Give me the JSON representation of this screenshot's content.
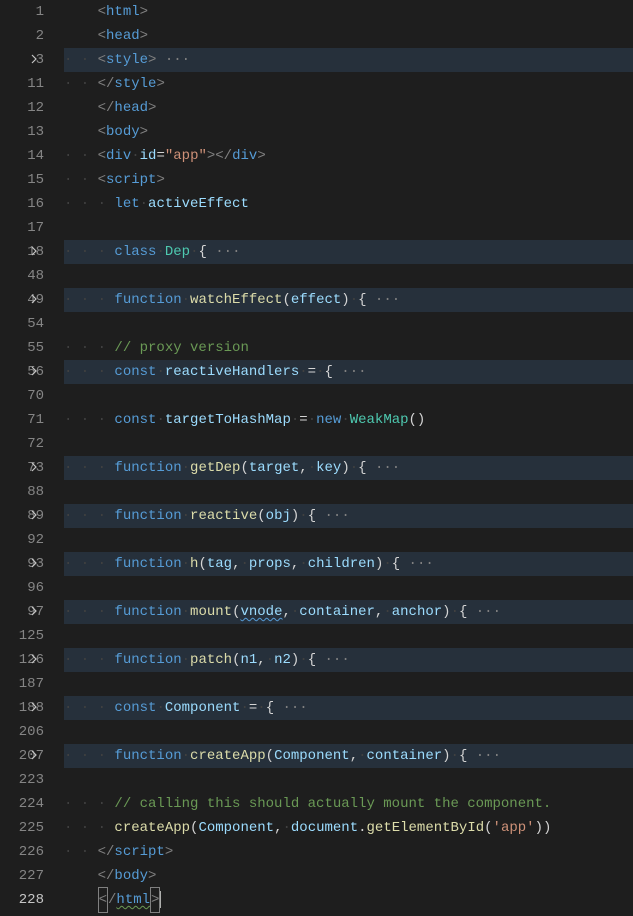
{
  "lines": [
    {
      "n": "1",
      "fold": false,
      "folded": false,
      "active": false,
      "seg": [
        {
          "t": "ws",
          "v": "    "
        },
        {
          "t": "tag-bracket",
          "v": "<"
        },
        {
          "t": "tag-name",
          "v": "html"
        },
        {
          "t": "tag-bracket",
          "v": ">"
        }
      ]
    },
    {
      "n": "2",
      "fold": false,
      "folded": false,
      "active": false,
      "seg": [
        {
          "t": "ws",
          "v": "    "
        },
        {
          "t": "tag-bracket",
          "v": "<"
        },
        {
          "t": "tag-name",
          "v": "head"
        },
        {
          "t": "tag-bracket",
          "v": ">"
        }
      ]
    },
    {
      "n": "3",
      "fold": true,
      "folded": true,
      "active": false,
      "seg": [
        {
          "t": "ws",
          "v": "· · "
        },
        {
          "t": "tag-bracket",
          "v": "<"
        },
        {
          "t": "tag-name",
          "v": "style"
        },
        {
          "t": "tag-bracket",
          "v": ">"
        },
        {
          "t": "ellipsis",
          "v": " ···"
        }
      ]
    },
    {
      "n": "11",
      "fold": false,
      "folded": false,
      "active": false,
      "seg": [
        {
          "t": "ws",
          "v": "· · "
        },
        {
          "t": "tag-bracket",
          "v": "</"
        },
        {
          "t": "tag-name",
          "v": "style"
        },
        {
          "t": "tag-bracket",
          "v": ">"
        }
      ]
    },
    {
      "n": "12",
      "fold": false,
      "folded": false,
      "active": false,
      "seg": [
        {
          "t": "ws",
          "v": "    "
        },
        {
          "t": "tag-bracket",
          "v": "</"
        },
        {
          "t": "tag-name",
          "v": "head"
        },
        {
          "t": "tag-bracket",
          "v": ">"
        }
      ]
    },
    {
      "n": "13",
      "fold": false,
      "folded": false,
      "active": false,
      "seg": [
        {
          "t": "ws",
          "v": "    "
        },
        {
          "t": "tag-bracket",
          "v": "<"
        },
        {
          "t": "tag-name",
          "v": "body"
        },
        {
          "t": "tag-bracket",
          "v": ">"
        }
      ]
    },
    {
      "n": "14",
      "fold": false,
      "folded": false,
      "active": false,
      "seg": [
        {
          "t": "ws",
          "v": "· · "
        },
        {
          "t": "tag-bracket",
          "v": "<"
        },
        {
          "t": "tag-name",
          "v": "div"
        },
        {
          "t": "ws",
          "v": " "
        },
        {
          "t": "attr-name",
          "v": "id"
        },
        {
          "t": "op",
          "v": "="
        },
        {
          "t": "attr-value",
          "v": "\"app\""
        },
        {
          "t": "tag-bracket",
          "v": "></"
        },
        {
          "t": "tag-name",
          "v": "div"
        },
        {
          "t": "tag-bracket",
          "v": ">"
        }
      ]
    },
    {
      "n": "15",
      "fold": false,
      "folded": false,
      "active": false,
      "seg": [
        {
          "t": "ws",
          "v": "· · "
        },
        {
          "t": "tag-bracket",
          "v": "<"
        },
        {
          "t": "tag-name",
          "v": "script"
        },
        {
          "t": "tag-bracket",
          "v": ">"
        }
      ]
    },
    {
      "n": "16",
      "fold": false,
      "folded": false,
      "active": false,
      "seg": [
        {
          "t": "ws",
          "v": "· · · "
        },
        {
          "t": "keyword-let",
          "v": "let"
        },
        {
          "t": "ws",
          "v": " "
        },
        {
          "t": "var",
          "v": "activeEffect"
        }
      ]
    },
    {
      "n": "17",
      "fold": false,
      "folded": false,
      "active": false,
      "seg": []
    },
    {
      "n": "18",
      "fold": true,
      "folded": true,
      "active": false,
      "seg": [
        {
          "t": "ws",
          "v": "· · · "
        },
        {
          "t": "keyword-class",
          "v": "class"
        },
        {
          "t": "ws",
          "v": " "
        },
        {
          "t": "classname",
          "v": "Dep"
        },
        {
          "t": "ws",
          "v": " "
        },
        {
          "t": "brace",
          "v": "{"
        },
        {
          "t": "ellipsis",
          "v": " ···"
        }
      ]
    },
    {
      "n": "48",
      "fold": false,
      "folded": false,
      "active": false,
      "seg": []
    },
    {
      "n": "49",
      "fold": true,
      "folded": true,
      "active": false,
      "seg": [
        {
          "t": "ws",
          "v": "· · · "
        },
        {
          "t": "keyword-function",
          "v": "function"
        },
        {
          "t": "ws",
          "v": " "
        },
        {
          "t": "funcname",
          "v": "watchEffect"
        },
        {
          "t": "brace",
          "v": "("
        },
        {
          "t": "param",
          "v": "effect"
        },
        {
          "t": "brace",
          "v": ")"
        },
        {
          "t": "ws",
          "v": " "
        },
        {
          "t": "brace",
          "v": "{"
        },
        {
          "t": "ellipsis",
          "v": " ···"
        }
      ]
    },
    {
      "n": "54",
      "fold": false,
      "folded": false,
      "active": false,
      "seg": []
    },
    {
      "n": "55",
      "fold": false,
      "folded": false,
      "active": false,
      "seg": [
        {
          "t": "ws",
          "v": "· · · "
        },
        {
          "t": "comment",
          "v": "// proxy version"
        }
      ]
    },
    {
      "n": "56",
      "fold": true,
      "folded": true,
      "active": false,
      "seg": [
        {
          "t": "ws",
          "v": "· · · "
        },
        {
          "t": "keyword-const",
          "v": "const"
        },
        {
          "t": "ws",
          "v": " "
        },
        {
          "t": "var",
          "v": "reactiveHandlers"
        },
        {
          "t": "ws",
          "v": " "
        },
        {
          "t": "op",
          "v": "="
        },
        {
          "t": "ws",
          "v": " "
        },
        {
          "t": "brace",
          "v": "{"
        },
        {
          "t": "ellipsis",
          "v": " ···"
        }
      ]
    },
    {
      "n": "70",
      "fold": false,
      "folded": false,
      "active": false,
      "seg": []
    },
    {
      "n": "71",
      "fold": false,
      "folded": false,
      "active": false,
      "seg": [
        {
          "t": "ws",
          "v": "· · · "
        },
        {
          "t": "keyword-const",
          "v": "const"
        },
        {
          "t": "ws",
          "v": " "
        },
        {
          "t": "var",
          "v": "targetToHashMap"
        },
        {
          "t": "ws",
          "v": " "
        },
        {
          "t": "op",
          "v": "="
        },
        {
          "t": "ws",
          "v": " "
        },
        {
          "t": "keyword-new",
          "v": "new"
        },
        {
          "t": "ws",
          "v": " "
        },
        {
          "t": "classname",
          "v": "WeakMap"
        },
        {
          "t": "brace",
          "v": "()"
        }
      ]
    },
    {
      "n": "72",
      "fold": false,
      "folded": false,
      "active": false,
      "seg": []
    },
    {
      "n": "73",
      "fold": true,
      "folded": true,
      "active": false,
      "seg": [
        {
          "t": "ws",
          "v": "· · · "
        },
        {
          "t": "keyword-function",
          "v": "function"
        },
        {
          "t": "ws",
          "v": " "
        },
        {
          "t": "funcname",
          "v": "getDep"
        },
        {
          "t": "brace",
          "v": "("
        },
        {
          "t": "param",
          "v": "target"
        },
        {
          "t": "op",
          "v": ","
        },
        {
          "t": "ws",
          "v": " "
        },
        {
          "t": "param",
          "v": "key"
        },
        {
          "t": "brace",
          "v": ")"
        },
        {
          "t": "ws",
          "v": " "
        },
        {
          "t": "brace",
          "v": "{"
        },
        {
          "t": "ellipsis",
          "v": " ···"
        }
      ]
    },
    {
      "n": "88",
      "fold": false,
      "folded": false,
      "active": false,
      "seg": []
    },
    {
      "n": "89",
      "fold": true,
      "folded": true,
      "active": false,
      "seg": [
        {
          "t": "ws",
          "v": "· · · "
        },
        {
          "t": "keyword-function",
          "v": "function"
        },
        {
          "t": "ws",
          "v": " "
        },
        {
          "t": "funcname",
          "v": "reactive"
        },
        {
          "t": "brace",
          "v": "("
        },
        {
          "t": "param",
          "v": "obj"
        },
        {
          "t": "brace",
          "v": ")"
        },
        {
          "t": "ws",
          "v": " "
        },
        {
          "t": "brace",
          "v": "{"
        },
        {
          "t": "ellipsis",
          "v": " ···"
        }
      ]
    },
    {
      "n": "92",
      "fold": false,
      "folded": false,
      "active": false,
      "seg": []
    },
    {
      "n": "93",
      "fold": true,
      "folded": true,
      "active": false,
      "seg": [
        {
          "t": "ws",
          "v": "· · · "
        },
        {
          "t": "keyword-function",
          "v": "function"
        },
        {
          "t": "ws",
          "v": " "
        },
        {
          "t": "funcname",
          "v": "h"
        },
        {
          "t": "brace",
          "v": "("
        },
        {
          "t": "param",
          "v": "tag"
        },
        {
          "t": "op",
          "v": ","
        },
        {
          "t": "ws",
          "v": " "
        },
        {
          "t": "param",
          "v": "props"
        },
        {
          "t": "op",
          "v": ","
        },
        {
          "t": "ws",
          "v": " "
        },
        {
          "t": "param",
          "v": "children"
        },
        {
          "t": "brace",
          "v": ")"
        },
        {
          "t": "ws",
          "v": " "
        },
        {
          "t": "brace",
          "v": "{"
        },
        {
          "t": "ellipsis",
          "v": " ···"
        }
      ]
    },
    {
      "n": "96",
      "fold": false,
      "folded": false,
      "active": false,
      "seg": []
    },
    {
      "n": "97",
      "fold": true,
      "folded": true,
      "active": false,
      "seg": [
        {
          "t": "ws",
          "v": "· · · "
        },
        {
          "t": "keyword-function",
          "v": "function"
        },
        {
          "t": "ws",
          "v": " "
        },
        {
          "t": "funcname",
          "v": "mount"
        },
        {
          "t": "brace",
          "v": "("
        },
        {
          "t": "param",
          "v": "vnode",
          "cls": "squiggle"
        },
        {
          "t": "op",
          "v": ","
        },
        {
          "t": "ws",
          "v": " "
        },
        {
          "t": "param",
          "v": "container"
        },
        {
          "t": "op",
          "v": ","
        },
        {
          "t": "ws",
          "v": " "
        },
        {
          "t": "param",
          "v": "anchor"
        },
        {
          "t": "brace",
          "v": ")"
        },
        {
          "t": "ws",
          "v": " "
        },
        {
          "t": "brace",
          "v": "{"
        },
        {
          "t": "ellipsis",
          "v": " ···"
        }
      ]
    },
    {
      "n": "125",
      "fold": false,
      "folded": false,
      "active": false,
      "seg": []
    },
    {
      "n": "126",
      "fold": true,
      "folded": true,
      "active": false,
      "seg": [
        {
          "t": "ws",
          "v": "· · · "
        },
        {
          "t": "keyword-function",
          "v": "function"
        },
        {
          "t": "ws",
          "v": " "
        },
        {
          "t": "funcname",
          "v": "patch"
        },
        {
          "t": "brace",
          "v": "("
        },
        {
          "t": "param",
          "v": "n1"
        },
        {
          "t": "op",
          "v": ","
        },
        {
          "t": "ws",
          "v": " "
        },
        {
          "t": "param",
          "v": "n2"
        },
        {
          "t": "brace",
          "v": ")"
        },
        {
          "t": "ws",
          "v": " "
        },
        {
          "t": "brace",
          "v": "{"
        },
        {
          "t": "ellipsis",
          "v": " ···"
        }
      ]
    },
    {
      "n": "187",
      "fold": false,
      "folded": false,
      "active": false,
      "seg": []
    },
    {
      "n": "188",
      "fold": true,
      "folded": true,
      "active": false,
      "seg": [
        {
          "t": "ws",
          "v": "· · · "
        },
        {
          "t": "keyword-const",
          "v": "const"
        },
        {
          "t": "ws",
          "v": " "
        },
        {
          "t": "var",
          "v": "Component"
        },
        {
          "t": "ws",
          "v": " "
        },
        {
          "t": "op",
          "v": "="
        },
        {
          "t": "ws",
          "v": " "
        },
        {
          "t": "brace",
          "v": "{"
        },
        {
          "t": "ellipsis",
          "v": " ···"
        }
      ]
    },
    {
      "n": "206",
      "fold": false,
      "folded": false,
      "active": false,
      "seg": []
    },
    {
      "n": "207",
      "fold": true,
      "folded": true,
      "active": false,
      "seg": [
        {
          "t": "ws",
          "v": "· · · "
        },
        {
          "t": "keyword-function",
          "v": "function"
        },
        {
          "t": "ws",
          "v": " "
        },
        {
          "t": "funcname",
          "v": "createApp"
        },
        {
          "t": "brace",
          "v": "("
        },
        {
          "t": "param",
          "v": "Component"
        },
        {
          "t": "op",
          "v": ","
        },
        {
          "t": "ws",
          "v": " "
        },
        {
          "t": "param",
          "v": "container"
        },
        {
          "t": "brace",
          "v": ")"
        },
        {
          "t": "ws",
          "v": " "
        },
        {
          "t": "brace",
          "v": "{"
        },
        {
          "t": "ellipsis",
          "v": " ···"
        }
      ]
    },
    {
      "n": "223",
      "fold": false,
      "folded": false,
      "active": false,
      "seg": []
    },
    {
      "n": "224",
      "fold": false,
      "folded": false,
      "active": false,
      "seg": [
        {
          "t": "ws",
          "v": "· · · "
        },
        {
          "t": "comment",
          "v": "// calling this should actually mount the component."
        }
      ]
    },
    {
      "n": "225",
      "fold": false,
      "folded": false,
      "active": false,
      "seg": [
        {
          "t": "ws",
          "v": "· · · "
        },
        {
          "t": "funcname",
          "v": "createApp"
        },
        {
          "t": "brace",
          "v": "("
        },
        {
          "t": "var",
          "v": "Component"
        },
        {
          "t": "op",
          "v": ","
        },
        {
          "t": "ws",
          "v": " "
        },
        {
          "t": "var",
          "v": "document"
        },
        {
          "t": "op",
          "v": "."
        },
        {
          "t": "funcname",
          "v": "getElementById"
        },
        {
          "t": "brace",
          "v": "("
        },
        {
          "t": "string",
          "v": "'app'"
        },
        {
          "t": "brace",
          "v": "))"
        }
      ]
    },
    {
      "n": "226",
      "fold": false,
      "folded": false,
      "active": false,
      "seg": [
        {
          "t": "ws",
          "v": "· · "
        },
        {
          "t": "tag-bracket",
          "v": "</"
        },
        {
          "t": "tag-name",
          "v": "script"
        },
        {
          "t": "tag-bracket",
          "v": ">"
        }
      ]
    },
    {
      "n": "227",
      "fold": false,
      "folded": false,
      "active": false,
      "seg": [
        {
          "t": "ws",
          "v": "    "
        },
        {
          "t": "tag-bracket",
          "v": "</"
        },
        {
          "t": "tag-name",
          "v": "body"
        },
        {
          "t": "tag-bracket",
          "v": ">"
        }
      ]
    },
    {
      "n": "228",
      "fold": false,
      "folded": false,
      "active": true,
      "seg": [
        {
          "t": "ws",
          "v": "    "
        },
        {
          "t": "tag-bracket",
          "v": "<",
          "box": true
        },
        {
          "t": "tag-bracket",
          "v": "/"
        },
        {
          "t": "tag-name",
          "v": "html",
          "cls": "squiggle-green"
        },
        {
          "t": "tag-bracket",
          "v": ">",
          "box": true
        },
        {
          "t": "cursor",
          "v": ""
        }
      ]
    }
  ]
}
